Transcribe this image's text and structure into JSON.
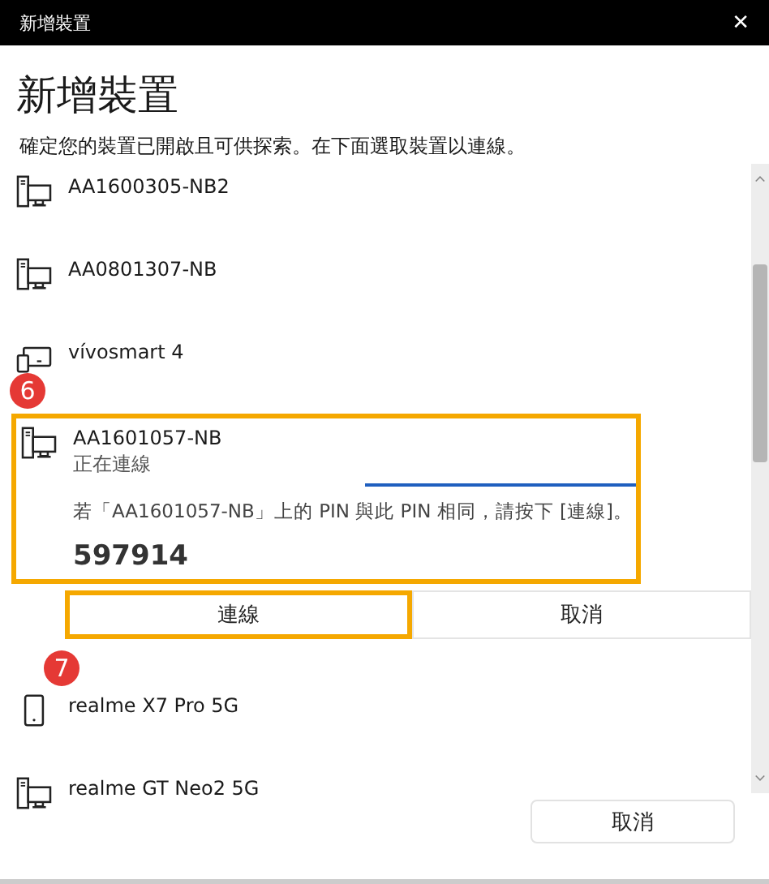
{
  "window": {
    "title": "新增裝置",
    "close": "✕"
  },
  "heading": "新增裝置",
  "instruction": "確定您的裝置已開啟且可供探索。在下面選取裝置以連線。",
  "devices": [
    {
      "kind": "computer",
      "name": "AA1600305-NB2",
      "expanded": false
    },
    {
      "kind": "computer",
      "name": "AA0801307-NB",
      "expanded": false
    },
    {
      "kind": "wearable",
      "name": "vívosmart 4",
      "expanded": false
    },
    {
      "kind": "computer",
      "name": "AA1601057-NB",
      "expanded": true,
      "badge": "6",
      "highlighted": true,
      "status": "正在連線",
      "message": "若「AA1601057-NB」上的 PIN 與此 PIN 相同，請按下 [連線]。",
      "pin": "597914",
      "buttons": [
        {
          "label": "連線",
          "highlighted": true
        },
        {
          "label": "取消",
          "highlighted": false
        }
      ]
    },
    {
      "kind": "phone",
      "name": "realme X7 Pro 5G",
      "expanded": false,
      "badge": "7"
    },
    {
      "kind": "computer",
      "name": "realme GT Neo2 5G",
      "expanded": false
    }
  ],
  "footer_button": "取消"
}
